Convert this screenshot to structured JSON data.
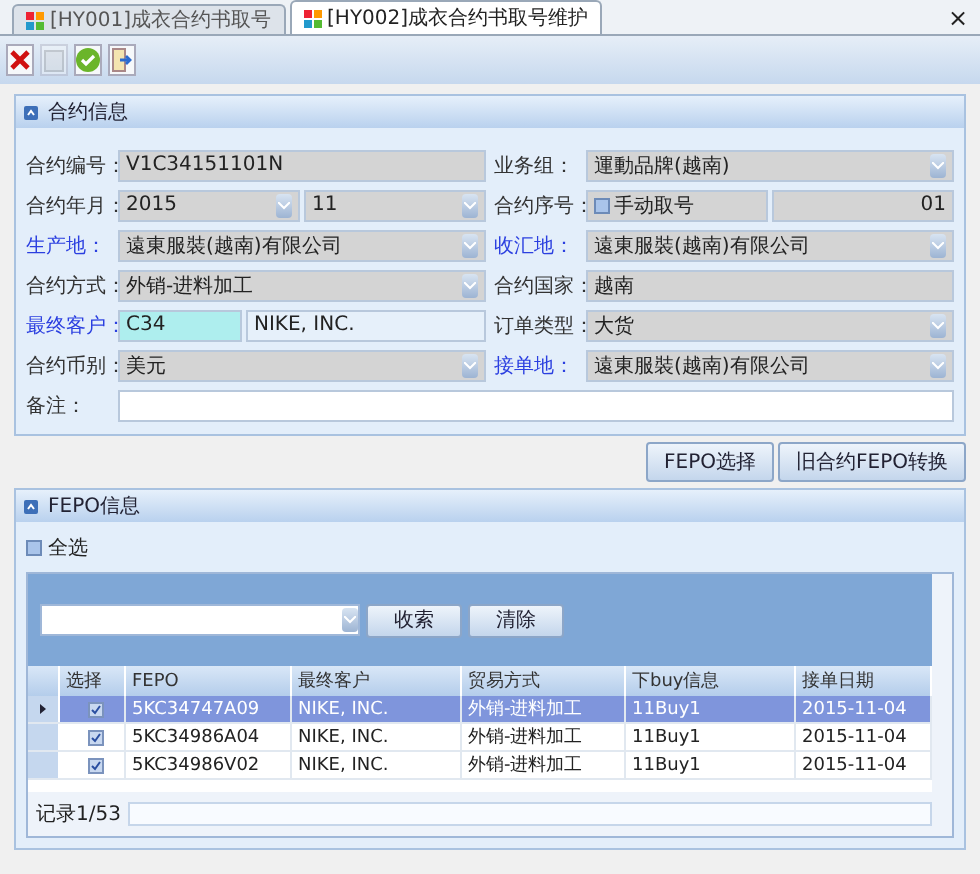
{
  "tabs": [
    {
      "label": "[HY001]成衣合约书取号",
      "selected": false
    },
    {
      "label": "[HY002]成衣合约书取号维护",
      "selected": true
    }
  ],
  "close_symbol": "×",
  "toolbar": [
    {
      "kind": "delete",
      "disabled": false
    },
    {
      "kind": "save",
      "disabled": true
    },
    {
      "kind": "confirm",
      "disabled": false
    },
    {
      "kind": "exit",
      "disabled": false
    }
  ],
  "contract_panel": {
    "title": "合约信息",
    "rows": [
      [
        {
          "label": "合约编号：",
          "highlight": false,
          "kind": "text",
          "values": [
            "V1C34151101N"
          ]
        },
        {
          "label": "业务组：",
          "highlight": false,
          "kind": "select",
          "values": [
            "運動品牌(越南)"
          ]
        }
      ],
      [
        {
          "label": "合约年月：",
          "highlight": false,
          "kind": "select-pair",
          "values": [
            "2015",
            "11"
          ]
        },
        {
          "label": "合约序号：",
          "highlight": false,
          "kind": "check-number",
          "check_label": "手动取号",
          "checked": false,
          "values": [
            "01"
          ]
        }
      ],
      [
        {
          "label": "生产地：",
          "highlight": true,
          "kind": "select",
          "values": [
            "遠東服裝(越南)有限公司"
          ]
        },
        {
          "label": "收汇地：",
          "highlight": true,
          "kind": "select",
          "values": [
            "遠東服裝(越南)有限公司"
          ]
        }
      ],
      [
        {
          "label": "合约方式：",
          "highlight": false,
          "kind": "select",
          "values": [
            "外销-进料加工"
          ]
        },
        {
          "label": "合约国家：",
          "highlight": false,
          "kind": "text",
          "values": [
            "越南"
          ]
        }
      ],
      [
        {
          "label": "最终客户：",
          "highlight": true,
          "kind": "code-name",
          "values": [
            "C34",
            "NIKE, INC."
          ]
        },
        {
          "label": "订单类型：",
          "highlight": false,
          "kind": "select",
          "values": [
            "大货"
          ]
        }
      ],
      [
        {
          "label": "合约币别：",
          "highlight": false,
          "kind": "select",
          "values": [
            "美元"
          ]
        },
        {
          "label": "接单地：",
          "highlight": true,
          "kind": "select",
          "values": [
            "遠東服裝(越南)有限公司"
          ]
        }
      ]
    ],
    "note": {
      "label": "备注："
    }
  },
  "buttons": [
    "FEPO选择",
    "旧合约FEPO转换"
  ],
  "fepo_panel": {
    "title": "FEPO信息",
    "select_all": {
      "label": "全选",
      "checked": false
    },
    "search_buttons": [
      "收索",
      "清除"
    ],
    "select_column": "选择",
    "columns": [
      "FEPO",
      "最终客户",
      "贸易方式",
      "下buy信息",
      "接单日期"
    ],
    "rows": [
      {
        "selected": true,
        "checked": true,
        "cells": [
          "5KC34747A09",
          "NIKE, INC.",
          "外销-进料加工",
          "11Buy1",
          "2015-11-04"
        ]
      },
      {
        "selected": false,
        "checked": true,
        "cells": [
          "5KC34986A04",
          "NIKE, INC.",
          "外销-进料加工",
          "11Buy1",
          "2015-11-04"
        ]
      },
      {
        "selected": false,
        "checked": true,
        "cells": [
          "5KC34986V02",
          "NIKE, INC.",
          "外销-进料加工",
          "11Buy1",
          "2015-11-04"
        ]
      }
    ],
    "record": "记录1/53"
  }
}
